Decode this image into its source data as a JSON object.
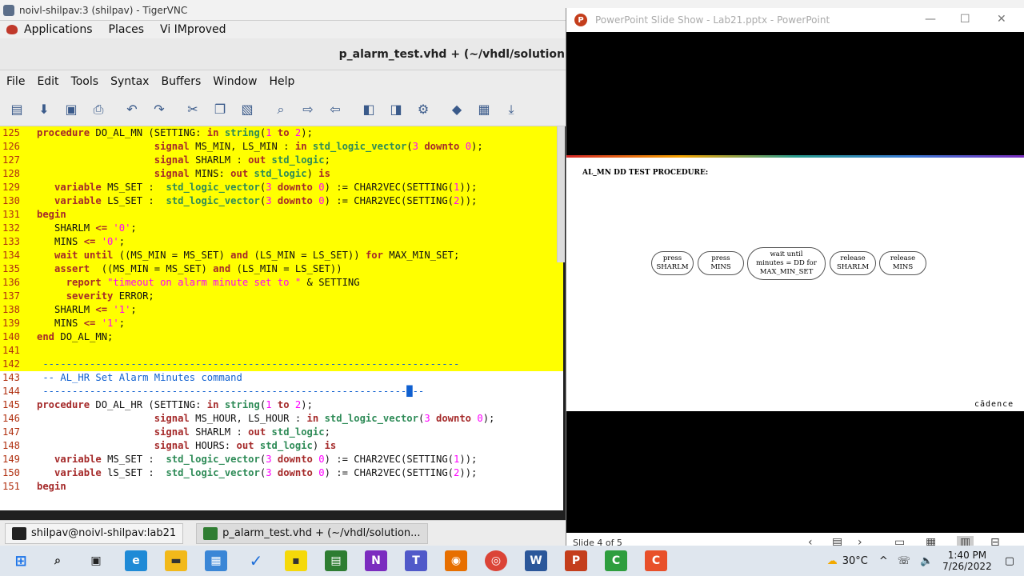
{
  "vnc": {
    "title": "noivl-shilpav:3 (shilpav) - TigerVNC"
  },
  "gnome": {
    "menus": [
      "Applications",
      "Places",
      "Vi IMproved"
    ]
  },
  "gvim": {
    "title": "p_alarm_test.vhd + (~/vhdl/solution",
    "menu": [
      "File",
      "Edit",
      "Tools",
      "Syntax",
      "Buffers",
      "Window",
      "Help"
    ]
  },
  "vnc_taskbar": {
    "terminal": "shilpav@noivl-shilpav:lab21",
    "editor": "p_alarm_test.vhd + (~/vhdl/solution..."
  },
  "ppt": {
    "title": "PowerPoint Slide Show  -  Lab21.pptx  -  PowerPoint",
    "slide_heading": "AL_MN DD TEST PROCEDURE:",
    "steps": [
      "press\nSHARLM",
      "press\nMINS",
      "wait until\nminutes = DD for\nMAX_MIN_SET",
      "release\nSHARLM",
      "release\nMINS"
    ],
    "logo": "cādence",
    "status": "Slide 4 of 5"
  },
  "taskbar": {
    "temp": "30°C",
    "time": "1:40 PM",
    "date": "7/26/2022"
  },
  "code": [
    {
      "n": "125",
      "hl": true,
      "t": [
        [
          "kw",
          "procedure "
        ],
        [
          "id",
          "DO_AL_MN (SETTING: "
        ],
        [
          "kw",
          "in "
        ],
        [
          "ty",
          "string"
        ],
        [
          "op",
          "("
        ],
        [
          "nm",
          "1"
        ],
        [
          "op",
          " "
        ],
        [
          "kw",
          "to "
        ],
        [
          "nm",
          "2"
        ],
        [
          "op",
          ");"
        ]
      ]
    },
    {
      "n": "126",
      "hl": true,
      "t": [
        [
          "id",
          "                    "
        ],
        [
          "kw",
          "signal "
        ],
        [
          "id",
          "MS_MIN, LS_MIN : "
        ],
        [
          "kw",
          "in "
        ],
        [
          "ty",
          "std_logic_vector"
        ],
        [
          "op",
          "("
        ],
        [
          "nm",
          "3"
        ],
        [
          "op",
          " "
        ],
        [
          "kw",
          "downto "
        ],
        [
          "nm",
          "0"
        ],
        [
          "op",
          ");"
        ]
      ]
    },
    {
      "n": "127",
      "hl": true,
      "t": [
        [
          "id",
          "                    "
        ],
        [
          "kw",
          "signal "
        ],
        [
          "id",
          "SHARLM : "
        ],
        [
          "kw",
          "out "
        ],
        [
          "ty",
          "std_logic"
        ],
        [
          "op",
          ";"
        ]
      ]
    },
    {
      "n": "128",
      "hl": true,
      "t": [
        [
          "id",
          "                    "
        ],
        [
          "kw",
          "signal "
        ],
        [
          "id",
          "MINS: "
        ],
        [
          "kw",
          "out "
        ],
        [
          "ty",
          "std_logic"
        ],
        [
          "op",
          ") "
        ],
        [
          "kw",
          "is"
        ]
      ]
    },
    {
      "n": "129",
      "hl": true,
      "t": [
        [
          "id",
          "   "
        ],
        [
          "kw",
          "variable "
        ],
        [
          "id",
          "MS_SET :  "
        ],
        [
          "ty",
          "std_logic_vector"
        ],
        [
          "op",
          "("
        ],
        [
          "nm",
          "3"
        ],
        [
          "op",
          " "
        ],
        [
          "kw",
          "downto "
        ],
        [
          "nm",
          "0"
        ],
        [
          "op",
          ") := CHAR2VEC(SETTING("
        ],
        [
          "nm",
          "1"
        ],
        [
          "op",
          "));"
        ]
      ]
    },
    {
      "n": "130",
      "hl": true,
      "t": [
        [
          "id",
          "   "
        ],
        [
          "kw",
          "variable "
        ],
        [
          "id",
          "LS_SET :  "
        ],
        [
          "ty",
          "std_logic_vector"
        ],
        [
          "op",
          "("
        ],
        [
          "nm",
          "3"
        ],
        [
          "op",
          " "
        ],
        [
          "kw",
          "downto "
        ],
        [
          "nm",
          "0"
        ],
        [
          "op",
          ") := CHAR2VEC(SETTING("
        ],
        [
          "nm",
          "2"
        ],
        [
          "op",
          "));"
        ]
      ]
    },
    {
      "n": "131",
      "hl": true,
      "t": [
        [
          "kw",
          "begin"
        ]
      ]
    },
    {
      "n": "132",
      "hl": true,
      "t": [
        [
          "id",
          "   SHARLM "
        ],
        [
          "kw",
          "<= "
        ],
        [
          "st",
          "'0'"
        ],
        [
          "op",
          ";"
        ]
      ]
    },
    {
      "n": "133",
      "hl": true,
      "t": [
        [
          "id",
          "   MINS "
        ],
        [
          "kw",
          "<= "
        ],
        [
          "st",
          "'0'"
        ],
        [
          "op",
          ";"
        ]
      ]
    },
    {
      "n": "134",
      "hl": true,
      "t": [
        [
          "id",
          "   "
        ],
        [
          "kw",
          "wait until "
        ],
        [
          "op",
          "((MS_MIN = MS_SET) "
        ],
        [
          "kw",
          "and "
        ],
        [
          "op",
          "(LS_MIN = LS_SET)) "
        ],
        [
          "kw",
          "for "
        ],
        [
          "id",
          "MAX_MIN_SET;"
        ]
      ]
    },
    {
      "n": "135",
      "hl": true,
      "t": [
        [
          "id",
          "   "
        ],
        [
          "kw",
          "assert  "
        ],
        [
          "op",
          "((MS_MIN = MS_SET) "
        ],
        [
          "kw",
          "and "
        ],
        [
          "op",
          "(LS_MIN = LS_SET))"
        ]
      ]
    },
    {
      "n": "136",
      "hl": true,
      "t": [
        [
          "id",
          "     "
        ],
        [
          "kw",
          "report "
        ],
        [
          "st",
          "\"timeout on alarm minute set to \" "
        ],
        [
          "op",
          "& SETTING"
        ]
      ]
    },
    {
      "n": "137",
      "hl": true,
      "t": [
        [
          "id",
          "     "
        ],
        [
          "kw",
          "severity "
        ],
        [
          "id",
          "ERROR;"
        ]
      ]
    },
    {
      "n": "138",
      "hl": true,
      "t": [
        [
          "id",
          "   SHARLM "
        ],
        [
          "kw",
          "<= "
        ],
        [
          "st",
          "'1'"
        ],
        [
          "op",
          ";"
        ]
      ]
    },
    {
      "n": "139",
      "hl": true,
      "t": [
        [
          "id",
          "   MINS "
        ],
        [
          "kw",
          "<= "
        ],
        [
          "st",
          "'1'"
        ],
        [
          "op",
          ";"
        ]
      ]
    },
    {
      "n": "140",
      "hl": true,
      "t": [
        [
          "kw",
          "end "
        ],
        [
          "id",
          "DO_AL_MN;"
        ]
      ]
    },
    {
      "n": "141",
      "hl": true,
      "t": []
    },
    {
      "n": "142",
      "hl": true,
      "t": [
        [
          "cm",
          " -----------------------------------------------------------------------"
        ]
      ]
    },
    {
      "n": "143",
      "hl": false,
      "t": [
        [
          "cm",
          " -- AL_HR Set Alarm Minutes command"
        ]
      ]
    },
    {
      "n": "144",
      "hl": false,
      "t": [
        [
          "cm",
          " --------------------------------------------------------------█--"
        ]
      ]
    },
    {
      "n": "145",
      "hl": false,
      "t": [
        [
          "kw",
          "procedure "
        ],
        [
          "id",
          "DO_AL_HR (SETTING: "
        ],
        [
          "kw",
          "in "
        ],
        [
          "ty",
          "string"
        ],
        [
          "op",
          "("
        ],
        [
          "nm",
          "1"
        ],
        [
          "op",
          " "
        ],
        [
          "kw",
          "to "
        ],
        [
          "nm",
          "2"
        ],
        [
          "op",
          ");"
        ]
      ]
    },
    {
      "n": "146",
      "hl": false,
      "t": [
        [
          "id",
          "                    "
        ],
        [
          "kw",
          "signal "
        ],
        [
          "id",
          "MS_HOUR, LS_HOUR : "
        ],
        [
          "kw",
          "in "
        ],
        [
          "ty",
          "std_logic_vector"
        ],
        [
          "op",
          "("
        ],
        [
          "nm",
          "3"
        ],
        [
          "op",
          " "
        ],
        [
          "kw",
          "downto "
        ],
        [
          "nm",
          "0"
        ],
        [
          "op",
          ");"
        ]
      ]
    },
    {
      "n": "147",
      "hl": false,
      "t": [
        [
          "id",
          "                    "
        ],
        [
          "kw",
          "signal "
        ],
        [
          "id",
          "SHARLM : "
        ],
        [
          "kw",
          "out "
        ],
        [
          "ty",
          "std_logic"
        ],
        [
          "op",
          ";"
        ]
      ]
    },
    {
      "n": "148",
      "hl": false,
      "t": [
        [
          "id",
          "                    "
        ],
        [
          "kw",
          "signal "
        ],
        [
          "id",
          "HOURS: "
        ],
        [
          "kw",
          "out "
        ],
        [
          "ty",
          "std_logic"
        ],
        [
          "op",
          ") "
        ],
        [
          "kw",
          "is"
        ]
      ]
    },
    {
      "n": "149",
      "hl": false,
      "t": [
        [
          "id",
          "   "
        ],
        [
          "kw",
          "variable "
        ],
        [
          "id",
          "MS_SET :  "
        ],
        [
          "ty",
          "std_logic_vector"
        ],
        [
          "op",
          "("
        ],
        [
          "nm",
          "3"
        ],
        [
          "op",
          " "
        ],
        [
          "kw",
          "downto "
        ],
        [
          "nm",
          "0"
        ],
        [
          "op",
          ") := CHAR2VEC(SETTING("
        ],
        [
          "nm",
          "1"
        ],
        [
          "op",
          "));"
        ]
      ]
    },
    {
      "n": "150",
      "hl": false,
      "t": [
        [
          "id",
          "   "
        ],
        [
          "kw",
          "variable "
        ],
        [
          "id",
          "lS_SET :  "
        ],
        [
          "ty",
          "std_logic_vector"
        ],
        [
          "op",
          "("
        ],
        [
          "nm",
          "3"
        ],
        [
          "op",
          " "
        ],
        [
          "kw",
          "downto "
        ],
        [
          "nm",
          "0"
        ],
        [
          "op",
          ") := CHAR2VEC(SETTING("
        ],
        [
          "nm",
          "2"
        ],
        [
          "op",
          "));"
        ]
      ]
    },
    {
      "n": "151",
      "hl": false,
      "t": [
        [
          "kw",
          "begin"
        ]
      ]
    }
  ]
}
